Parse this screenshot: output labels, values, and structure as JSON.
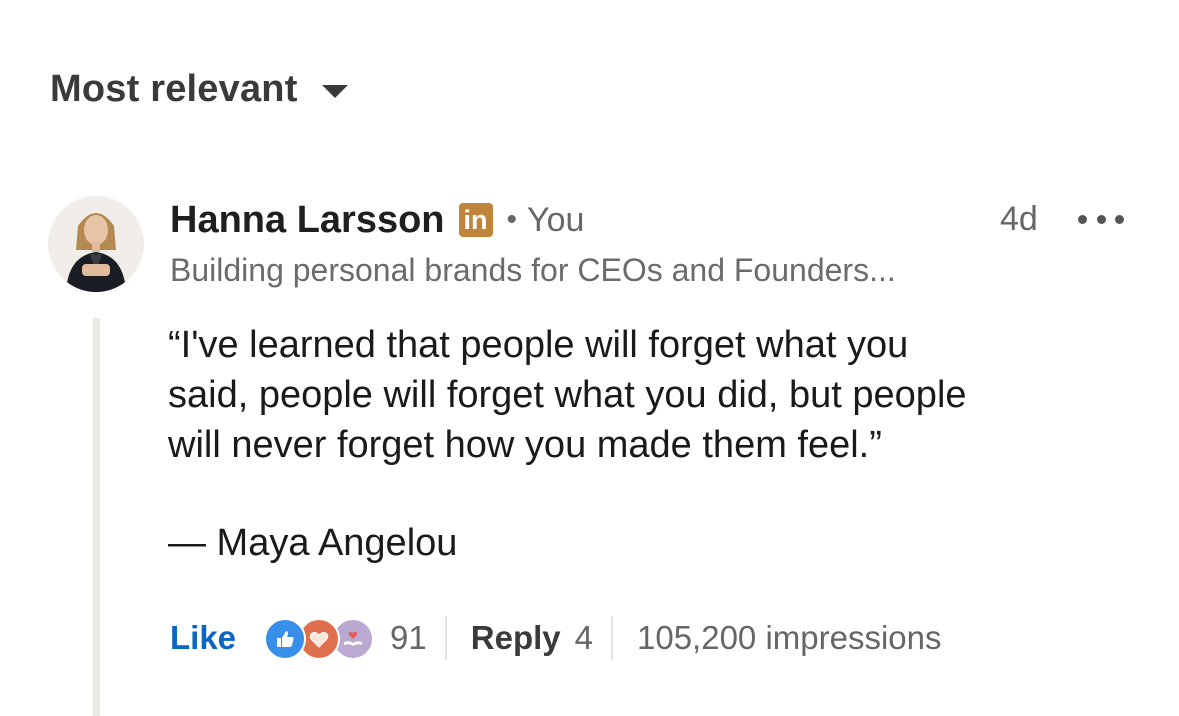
{
  "sort": {
    "label": "Most relevant"
  },
  "comment": {
    "author": {
      "name": "Hanna Larsson",
      "badge_icon": "linkedin-premium-icon",
      "badge_text": "in",
      "separator": "•",
      "relation": "You",
      "headline": "Building personal brands for CEOs and Founders..."
    },
    "time": "4d",
    "more_icon": "more-options-icon",
    "body": "“I've learned that people will forget what you\nsaid, people will forget what you did, but people\nwill never forget how you made them feel.”",
    "attribution": "— Maya Angelou",
    "actions": {
      "like_label": "Like",
      "reaction_icons": [
        "like-reaction-icon",
        "love-reaction-icon",
        "support-reaction-icon"
      ],
      "reaction_count": "91",
      "reply_label": "Reply",
      "reply_count": "4",
      "impressions": "105,200 impressions"
    }
  },
  "colors": {
    "like_blue": "#0a66c2",
    "badge_gold": "#c0853a",
    "secondary_text": "#666666",
    "thread_line": "#ebe9e4"
  }
}
